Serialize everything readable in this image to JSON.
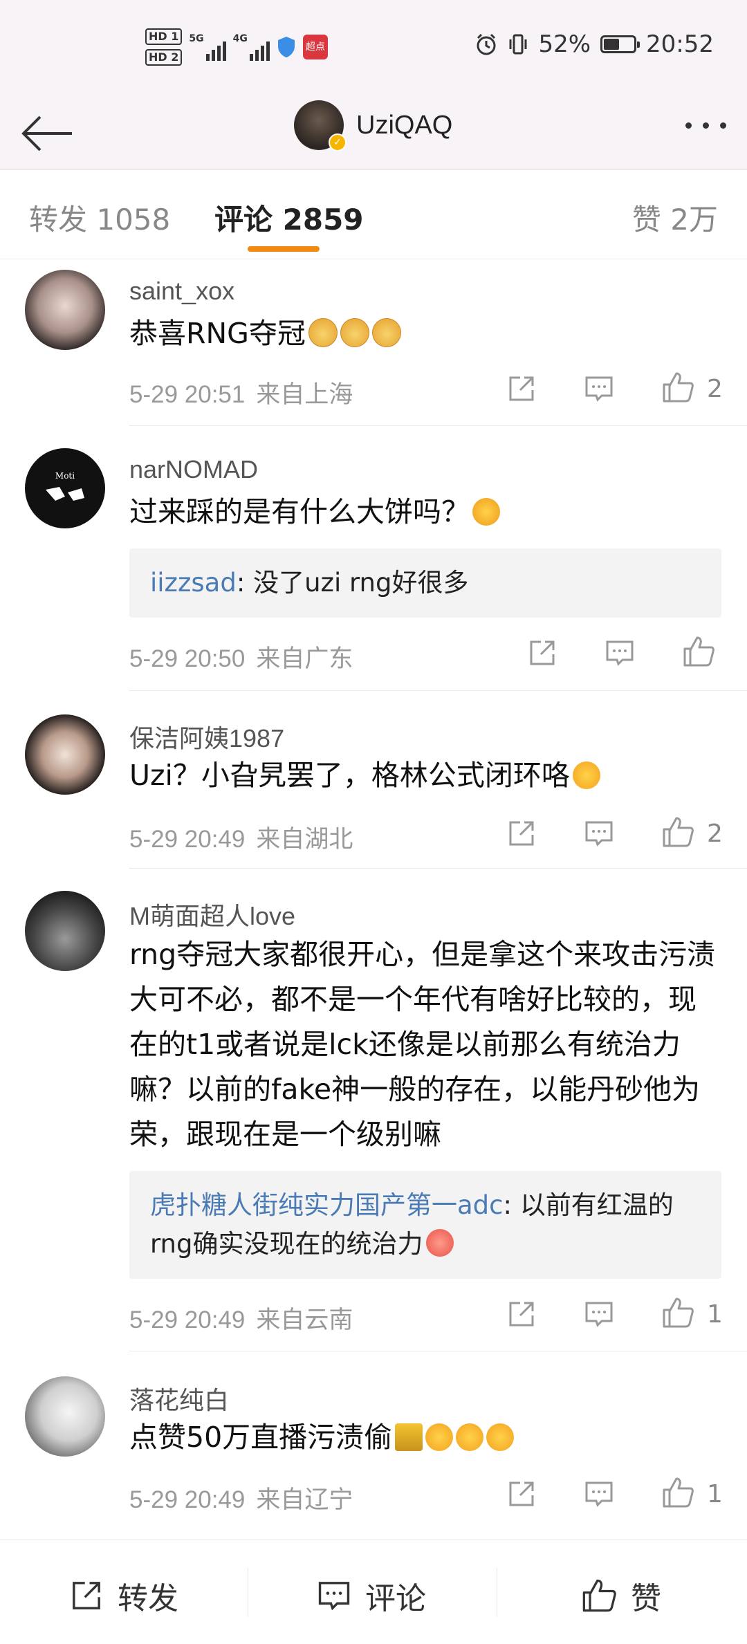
{
  "status_bar": {
    "hd1": "HD 1",
    "hd2": "HD 2",
    "net1": "5G",
    "net2": "4G",
    "app_badge": "超点",
    "battery": "52%",
    "battery_level": 0.52,
    "time": "20:52"
  },
  "nav": {
    "title": "UziQAQ",
    "verified": "✓"
  },
  "tabs": [
    {
      "label": "转发 1058"
    },
    {
      "label": "评论 2859",
      "active": true
    },
    {
      "label": "赞 2万"
    }
  ],
  "comments": [
    {
      "user": "saint_xox",
      "text": "恭喜RNG夺冠",
      "emojis": [
        "dog",
        "dog",
        "dog"
      ],
      "time": "5-29 20:51",
      "location": "来自上海",
      "likes": "2"
    },
    {
      "user": "narNOMAD",
      "text": "过来踩的是有什么大饼吗？",
      "emojis": [
        "laugh"
      ],
      "reply_user": "iizzsad",
      "reply_text": ": 没了uzi rng好很多",
      "time": "5-29 20:50",
      "location": "来自广东",
      "likes": ""
    },
    {
      "user": "保洁阿姨1987",
      "text": "Uzi？小旮旯罢了，格林公式闭环咯",
      "emojis": [
        "cry"
      ],
      "time": "5-29 20:49",
      "location": "来自湖北",
      "likes": "2"
    },
    {
      "user": "M萌面超人love",
      "text": "rng夺冠大家都很开心，但是拿这个来攻击污渍大可不必，都不是一个年代有啥好比较的，现在的t1或者说是lck还像是以前那么有统治力嘛？以前的fake神一般的存在，以能丹砂他为荣，跟现在是一个级别嘛",
      "reply_user": "虎扑糖人街纯实力国产第一adc",
      "reply_text": ": 以前有红温的rng确实没现在的统治力",
      "reply_emoji": "pig",
      "time": "5-29 20:49",
      "location": "来自云南",
      "likes": "1"
    },
    {
      "user": "落花纯白",
      "text": "点赞50万直播污渍偷",
      "emojis": [
        "trophy",
        "cry",
        "cry",
        "cry"
      ],
      "time": "5-29 20:49",
      "location": "来自辽宁",
      "likes": "1"
    }
  ],
  "bottom": {
    "repost": "转发",
    "comment": "评论",
    "like": "赞"
  },
  "colors": {
    "accent": "#f28a10",
    "link": "#4b7bb5",
    "header_bg": "#f8f3f6"
  }
}
